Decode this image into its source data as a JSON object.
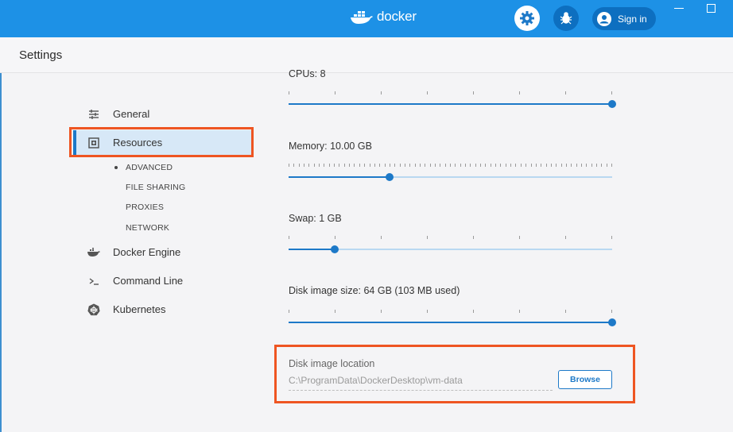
{
  "titlebar": {
    "brand": "docker",
    "signin_label": "Sign in",
    "accent": "#1d91e6"
  },
  "header": {
    "title": "Settings"
  },
  "sidebar": {
    "items": [
      {
        "label": "General",
        "icon": "sliders-icon"
      },
      {
        "label": "Resources",
        "icon": "resources-icon",
        "active": true
      },
      {
        "label": "Docker Engine",
        "icon": "whale-icon"
      },
      {
        "label": "Command Line",
        "icon": "terminal-icon"
      },
      {
        "label": "Kubernetes",
        "icon": "helm-icon"
      }
    ],
    "subitems": [
      {
        "label": "ADVANCED",
        "active": true
      },
      {
        "label": "FILE SHARING"
      },
      {
        "label": "PROXIES"
      },
      {
        "label": "NETWORK"
      }
    ]
  },
  "resources": {
    "cpus": {
      "label": "CPUs: 8",
      "fraction": 1.0
    },
    "memory": {
      "label": "Memory: 10.00 GB",
      "fraction": 0.313
    },
    "swap": {
      "label": "Swap: 1 GB",
      "fraction": 0.143
    },
    "disk_size": {
      "label": "Disk image size: 64 GB (103 MB used)",
      "fraction": 1.0
    },
    "disk_location": {
      "label": "Disk image location",
      "value": "C:\\ProgramData\\DockerDesktop\\vm-data",
      "browse_label": "Browse"
    }
  },
  "highlight_color": "#ee5522"
}
